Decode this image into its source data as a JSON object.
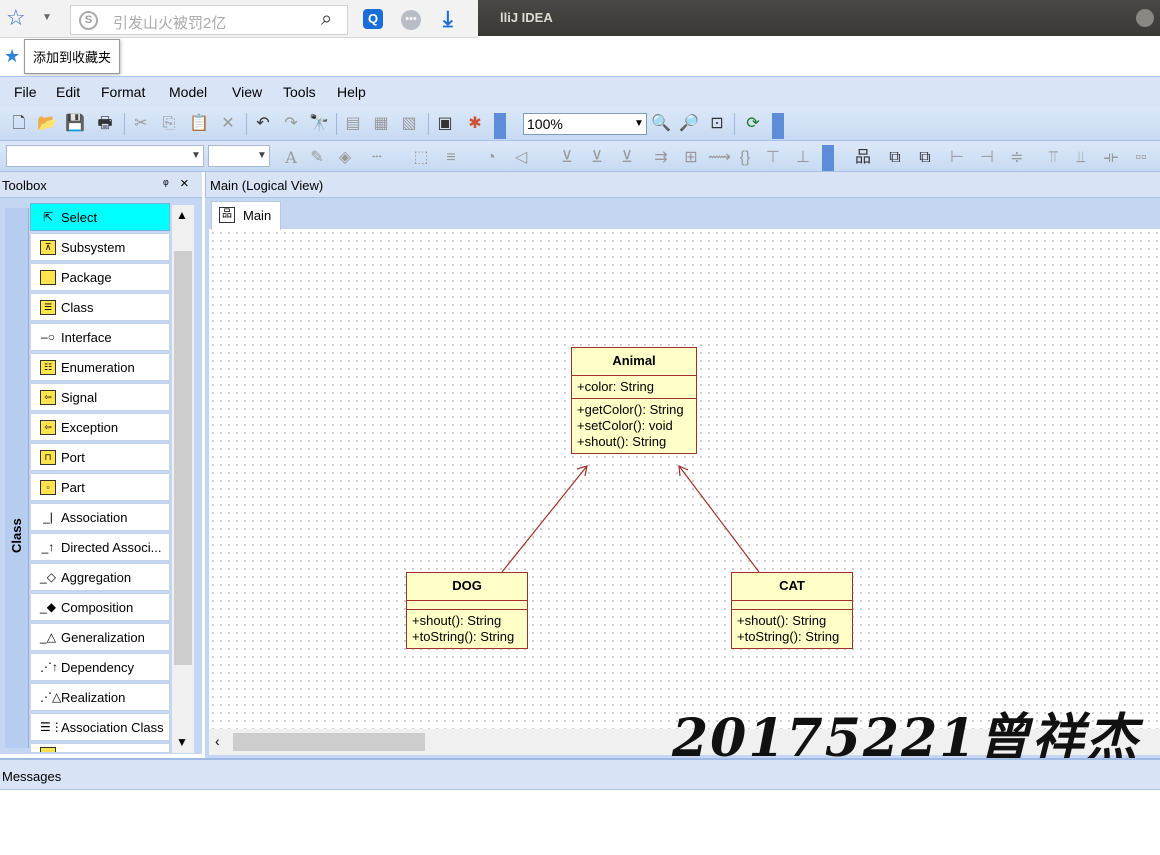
{
  "window": {
    "title": "lliJ IDEA"
  },
  "browser": {
    "search_placeholder": "引发山火被罚2亿",
    "search_badge": "S",
    "bookmark_tooltip": "添加到收藏夹"
  },
  "menu": [
    {
      "label": "File"
    },
    {
      "label": "Edit"
    },
    {
      "label": "Format"
    },
    {
      "label": "Model"
    },
    {
      "label": "View"
    },
    {
      "label": "Tools"
    },
    {
      "label": "Help"
    }
  ],
  "toolbar": {
    "zoom": "100%"
  },
  "toolbox": {
    "title": "Toolbox",
    "category": "Class",
    "items": [
      {
        "label": "Select",
        "icon": "pointer-icon",
        "selected": true
      },
      {
        "label": "Subsystem",
        "icon": "subsystem-icon"
      },
      {
        "label": "Package",
        "icon": "package-icon"
      },
      {
        "label": "Class",
        "icon": "class-icon"
      },
      {
        "label": "Interface",
        "icon": "interface-icon"
      },
      {
        "label": "Enumeration",
        "icon": "enumeration-icon"
      },
      {
        "label": "Signal",
        "icon": "signal-icon"
      },
      {
        "label": "Exception",
        "icon": "exception-icon"
      },
      {
        "label": "Port",
        "icon": "port-icon"
      },
      {
        "label": "Part",
        "icon": "part-icon"
      },
      {
        "label": "Association",
        "icon": "association-icon"
      },
      {
        "label": "Directed Associ...",
        "icon": "directed-association-icon"
      },
      {
        "label": "Aggregation",
        "icon": "aggregation-icon"
      },
      {
        "label": "Composition",
        "icon": "composition-icon"
      },
      {
        "label": "Generalization",
        "icon": "generalization-icon"
      },
      {
        "label": "Dependency",
        "icon": "dependency-icon"
      },
      {
        "label": "Realization",
        "icon": "realization-icon"
      },
      {
        "label": "Association Class",
        "icon": "association-class-icon"
      }
    ]
  },
  "diagram": {
    "header": "Main (Logical View)",
    "tab": "Main",
    "classes": {
      "animal": {
        "name": "Animal",
        "attributes": [
          "+color: String"
        ],
        "operations": [
          "+getColor(): String",
          "+setColor(): void",
          "+shout(): String"
        ]
      },
      "dog": {
        "name": "DOG",
        "attributes": [],
        "operations": [
          "+shout(): String",
          "+toString(): String"
        ]
      },
      "cat": {
        "name": "CAT",
        "attributes": [],
        "operations": [
          "+shout(): String",
          "+toString(): String"
        ]
      }
    },
    "watermark": "20175221曾祥杰"
  },
  "messages": {
    "title": "Messages"
  },
  "colors": {
    "selected": "#00ffff",
    "class_fill": "#ffffc8",
    "class_border": "#a0322a",
    "chrome": "#d8e4f6"
  }
}
